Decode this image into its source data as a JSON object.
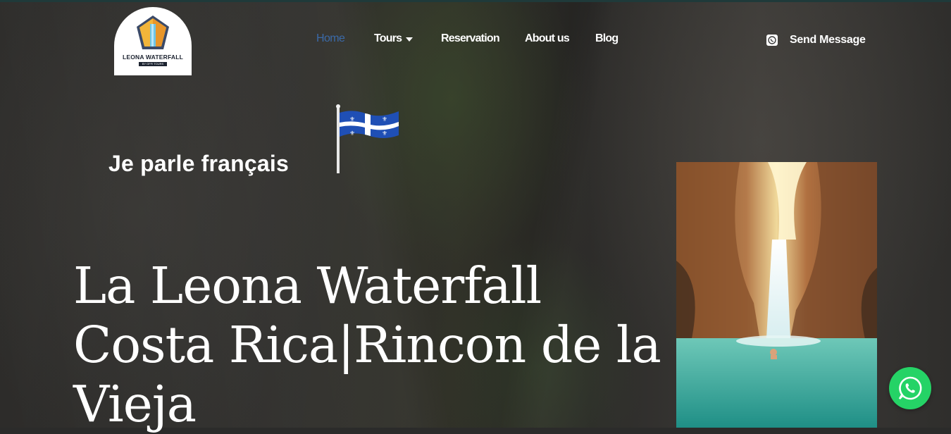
{
  "logo": {
    "title": "LEONA WATERFALL",
    "subtitle": "BY OFFI TOURS"
  },
  "nav": {
    "items": [
      {
        "label": "Home",
        "active": true
      },
      {
        "label": "Tours",
        "has_dropdown": true
      },
      {
        "label": "Reservation"
      },
      {
        "label": "About us"
      },
      {
        "label": "Blog"
      }
    ],
    "send_message": "Send Message"
  },
  "hero": {
    "language_note": "Je parle français",
    "headline_line1": "La Leona Waterfall",
    "headline_line2": "Costa Rica|Rincon de la",
    "headline_line3": "Vieja"
  },
  "icons": {
    "nav_caret": "chevron-down-icon",
    "send_message_icon": "whatsapp-icon",
    "floating_chat": "whatsapp-icon",
    "flag": "quebec-flag-icon"
  },
  "colors": {
    "nav_active": "#3b6aa8",
    "whatsapp_green": "#25d366",
    "text_white": "#ffffff"
  }
}
